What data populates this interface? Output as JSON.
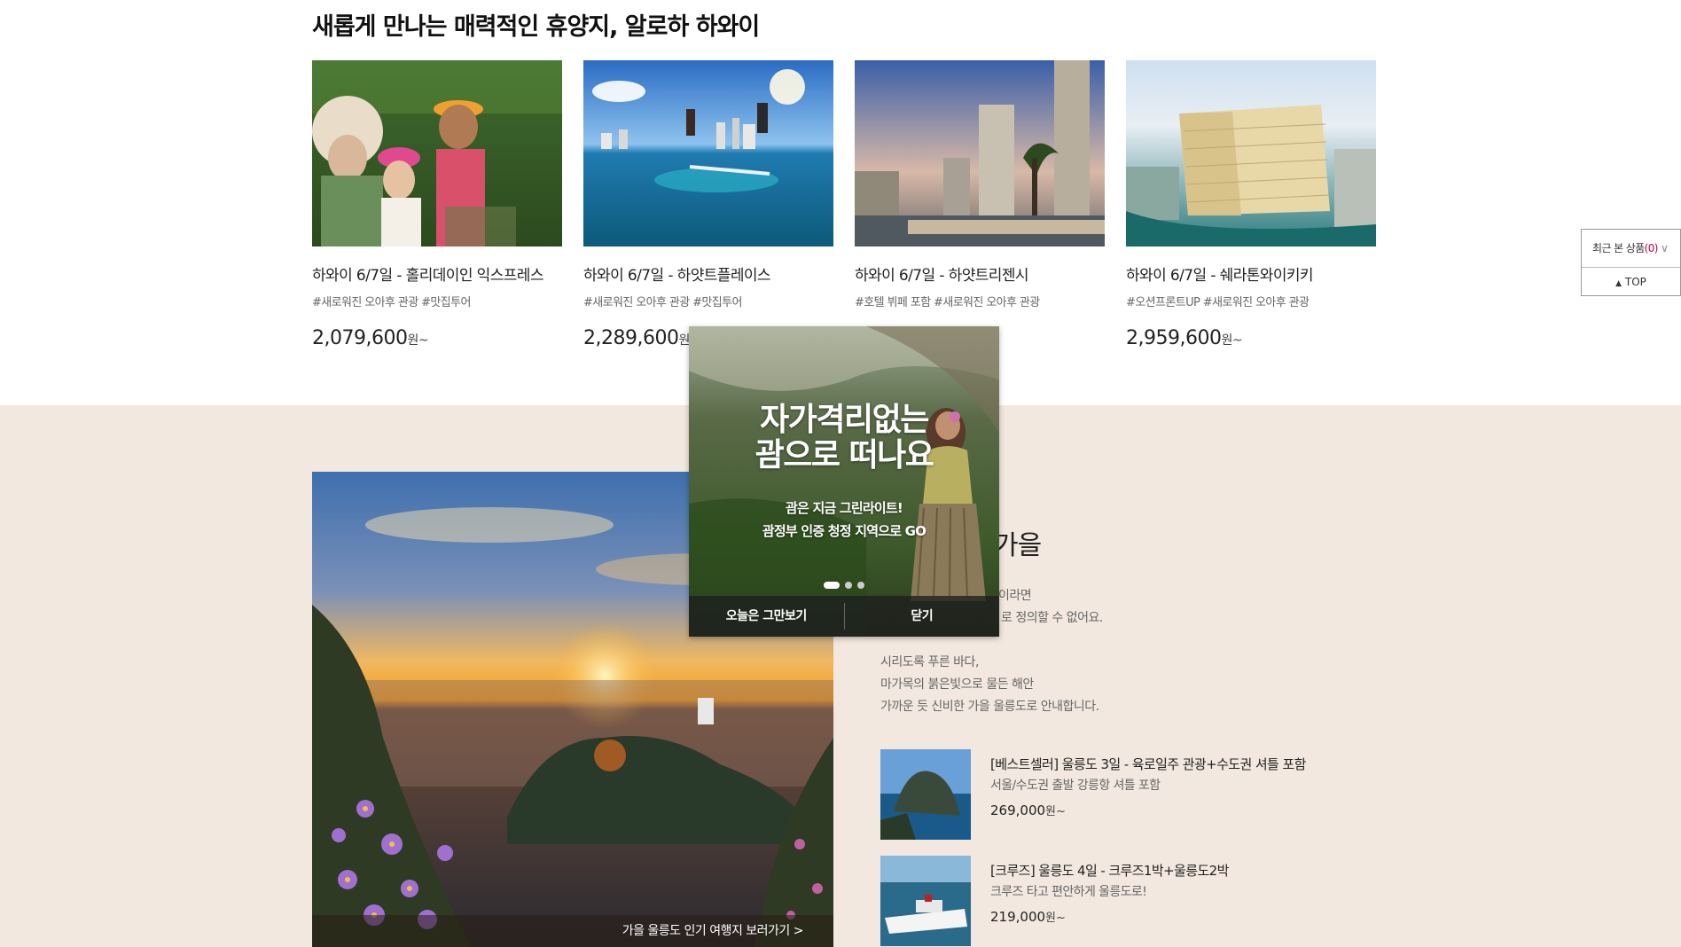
{
  "hawaii": {
    "title": "새롭게 만나는 매력적인 휴양지, 알로하 하와이",
    "cards": [
      {
        "name": "하와이 6/7일 - 홀리데이인 익스프레스",
        "tags": "#새로워진 오아후 관광 #맛집투어",
        "price": "2,079,600",
        "won": "원~"
      },
      {
        "name": "하와이 6/7일 - 하얏트플레이스",
        "tags": "#새로워진 오아후 관광 #맛집투어",
        "price": "2,289,600",
        "won": "원~"
      },
      {
        "name": "하와이 6/7일 - 하얏트리젠시",
        "tags": "#호텔 뷔페 포함 #새로워진 오아후 관광",
        "price": "",
        "won": ""
      },
      {
        "name": "하와이 6/7일 - 쉐라톤와이키키",
        "tags": "#오션프론트UP #새로워진 오아후 관광",
        "price": "2,959,600",
        "won": "원~"
      }
    ]
  },
  "ulleung": {
    "photo_caption": "가을 울릉도 인기 여행지 보러가기 >",
    "heading_fragment": "가을",
    "intro_line1": "이라면",
    "intro_line2": "로 정의할 수 없어요.",
    "body_lines": [
      "시리도록 푸른 바다,",
      "마가목의 붉은빛으로 물든 해안",
      "가까운 듯 신비한 가을 울릉도로 안내합니다."
    ],
    "products": [
      {
        "name": "[베스트셀러] 울릉도 3일 - 육로일주 관광+수도권 셔틀 포함",
        "desc": "서울/수도권 출발 강릉항 셔틀 포함",
        "price": "269,000",
        "won": "원~"
      },
      {
        "name": "[크루즈] 울릉도 4일 - 크루즈1박+울릉도2박",
        "desc": "크루즈 타고 편안하게 울릉도로!",
        "price": "219,000",
        "won": "원~"
      }
    ]
  },
  "recent": {
    "label": "최근 본 상품",
    "count": "(0)",
    "chevron": "∨",
    "top_arrow": "▲",
    "top_label": "TOP"
  },
  "popup": {
    "headline_line1": "자가격리없는",
    "headline_line2": "괌으로 떠나요",
    "sub_line1": "괌은 지금 그린라이트!",
    "sub_line2": "괌정부 인증 청정 지역으로 GO",
    "btn_today": "오늘은 그만보기",
    "btn_close": "닫기",
    "slide_count": 3,
    "active_slide": 1
  }
}
